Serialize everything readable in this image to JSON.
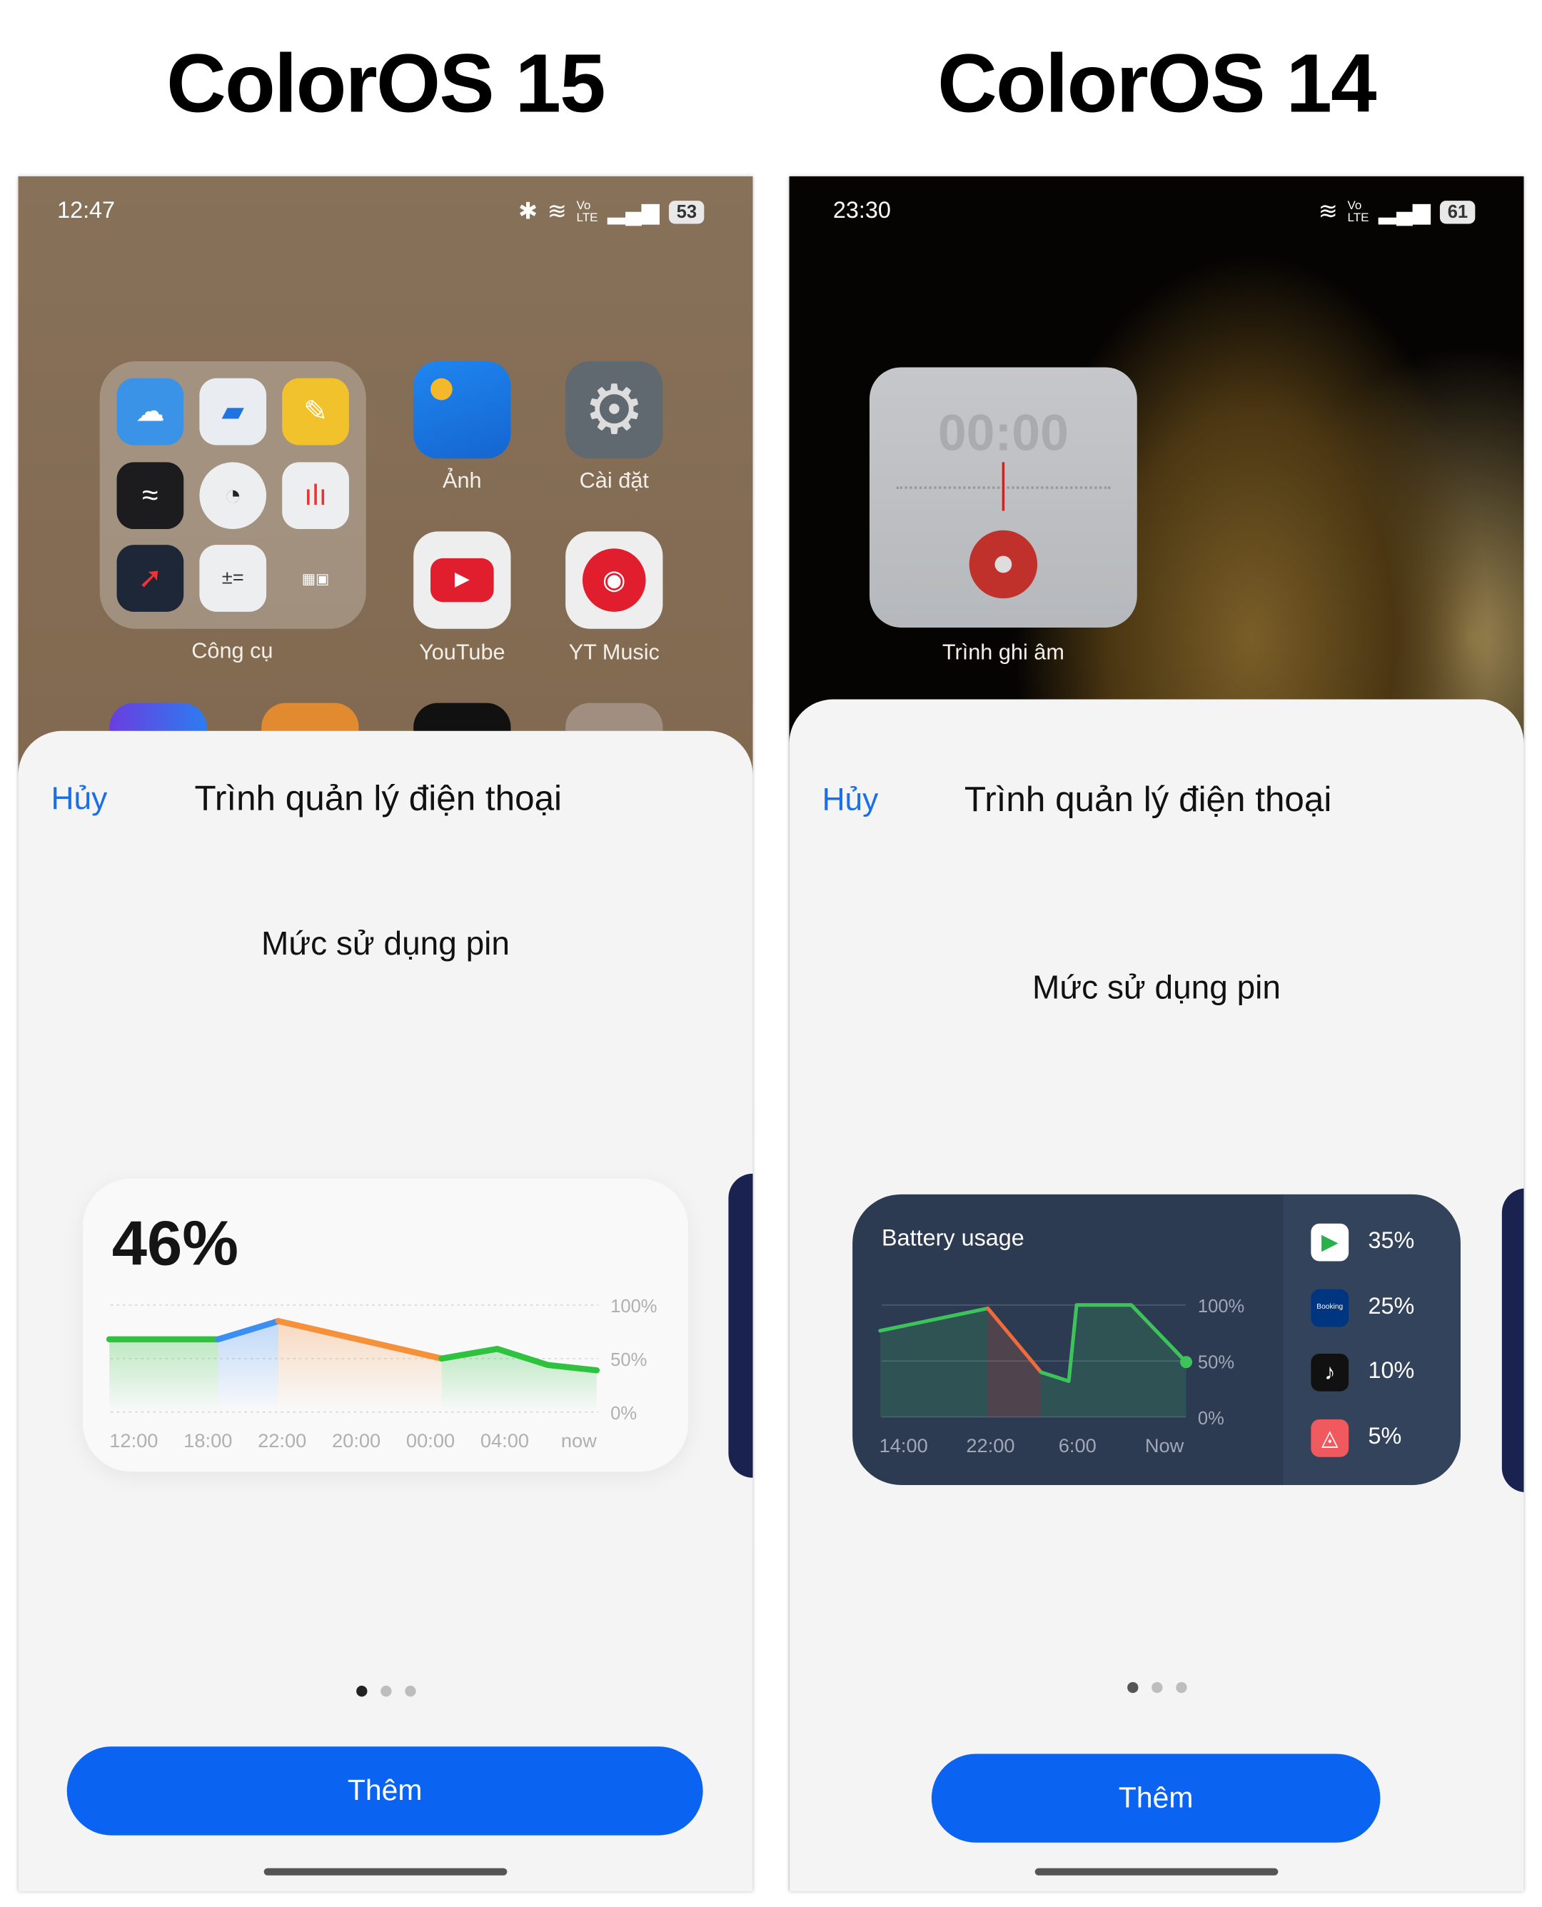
{
  "headings": {
    "left": "ColorOS 15",
    "right": "ColorOS 14"
  },
  "left_phone": {
    "status": {
      "time": "12:47",
      "battery": "53",
      "icons": [
        "bluetooth-icon",
        "wifi-icon",
        "volte-icon",
        "signal-icon",
        "battery-icon"
      ]
    },
    "home": {
      "folder": {
        "label": "Công cụ",
        "apps": [
          "weather",
          "files",
          "notes",
          "tools",
          "clock",
          "recorder",
          "compass",
          "calculator",
          "mini-folder"
        ]
      },
      "apps": [
        {
          "label": "Ảnh",
          "icon": "photos-icon"
        },
        {
          "label": "Cài đặt",
          "icon": "settings-icon"
        },
        {
          "label": "YouTube",
          "icon": "youtube-icon"
        },
        {
          "label": "YT Music",
          "icon": "yt-music-icon"
        }
      ]
    },
    "sheet": {
      "cancel": "Hủy",
      "title": "Trình quản lý điện thoại",
      "subtitle": "Mức sử dụng pin",
      "add": "Thêm",
      "page_count": 3,
      "active_page": 0
    },
    "widget": {
      "value": "46%"
    }
  },
  "right_phone": {
    "status": {
      "time": "23:30",
      "battery": "61",
      "icons": [
        "wifi-icon",
        "volte-icon",
        "signal-icon",
        "battery-icon"
      ]
    },
    "home": {
      "widget_time": "00:00",
      "widget_label": "Trình ghi âm"
    },
    "sheet": {
      "cancel": "Hủy",
      "title": "Trình quản lý điện thoại",
      "subtitle": "Mức sử dụng pin",
      "add": "Thêm",
      "page_count": 3,
      "active_page": 0
    },
    "widget": {
      "title": "Battery usage",
      "apps": [
        {
          "icon": "video-app-icon",
          "value": "35%",
          "color": "#ffffff"
        },
        {
          "icon": "booking-icon",
          "label": "Booking",
          "value": "25%",
          "color": "#003580"
        },
        {
          "icon": "tiktok-icon",
          "value": "10%",
          "color": "#111111"
        },
        {
          "icon": "airbnb-icon",
          "value": "5%",
          "color": "#f05a5f"
        }
      ]
    }
  },
  "chart_data": [
    {
      "type": "line",
      "xlabels": [
        "12:00",
        "18:00",
        "22:00",
        "20:00",
        "00:00",
        "04:00",
        "now"
      ],
      "ylabels": [
        "100%",
        "50%",
        "0%"
      ],
      "ylim": [
        0,
        100
      ],
      "grid": true,
      "points": [
        [
          -0.33,
          68
        ],
        [
          1.14,
          68
        ],
        [
          1.95,
          85
        ],
        [
          4.15,
          50
        ],
        [
          4.9,
          59
        ],
        [
          5.58,
          44
        ],
        [
          6.24,
          39
        ]
      ],
      "segments": [
        {
          "from": 0,
          "to": 1,
          "color": "#2fc23f"
        },
        {
          "from": 1,
          "to": 2,
          "color": "#3b8ff2"
        },
        {
          "from": 2,
          "to": 3,
          "color": "#f5913a"
        },
        {
          "from": 3,
          "to": 6,
          "color": "#2fc23f"
        }
      ]
    },
    {
      "type": "line",
      "xlabels": [
        "14:00",
        "22:00",
        "6:00",
        "Now"
      ],
      "ylabels": [
        "100%",
        "50%",
        "0%"
      ],
      "ylim": [
        0,
        100
      ],
      "grid": true,
      "points": [
        [
          -0.27,
          77
        ],
        [
          0.97,
          97
        ],
        [
          1.58,
          40
        ],
        [
          1.9,
          32
        ],
        [
          1.99,
          100
        ],
        [
          2.62,
          100
        ],
        [
          3.25,
          49
        ]
      ],
      "segments": [
        {
          "from": 0,
          "to": 1,
          "color": "#3cc35a"
        },
        {
          "from": 1,
          "to": 2,
          "color": "#f06b3a"
        },
        {
          "from": 2,
          "to": 6,
          "color": "#3cc35a"
        }
      ]
    }
  ]
}
